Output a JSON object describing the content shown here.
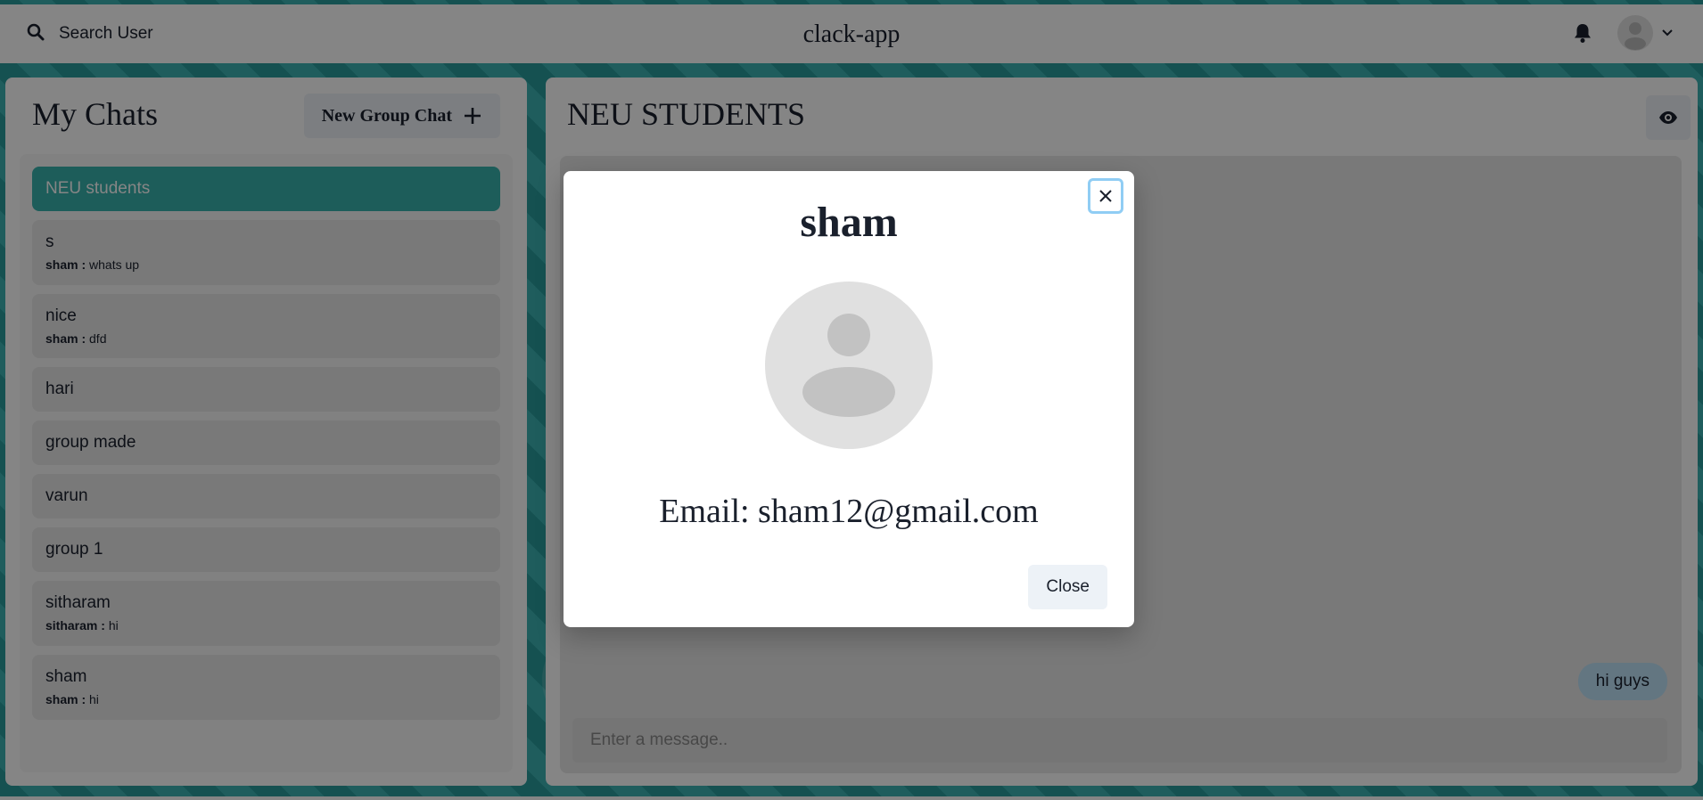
{
  "header": {
    "search_label": "Search User",
    "app_title": "clack-app",
    "bell_icon": "bell-icon",
    "avatar_icon": "user-avatar",
    "dropdown_icon": "chevron-down-icon"
  },
  "sidebar": {
    "title": "My Chats",
    "new_group_label": "New Group Chat",
    "chats": [
      {
        "name": "NEU students",
        "sender": "",
        "message": "",
        "active": true
      },
      {
        "name": "s",
        "sender": "sham :",
        "message": "whats up",
        "active": false
      },
      {
        "name": "nice",
        "sender": "sham :",
        "message": "dfd",
        "active": false
      },
      {
        "name": "hari",
        "sender": "",
        "message": "",
        "active": false
      },
      {
        "name": "group made",
        "sender": "",
        "message": "",
        "active": false
      },
      {
        "name": "varun",
        "sender": "",
        "message": "",
        "active": false
      },
      {
        "name": "group 1",
        "sender": "",
        "message": "",
        "active": false
      },
      {
        "name": "sitharam",
        "sender": "sitharam :",
        "message": "hi",
        "active": false
      },
      {
        "name": "sham",
        "sender": "sham :",
        "message": "hi",
        "active": false
      }
    ]
  },
  "chat": {
    "title": "NEU STUDENTS",
    "messages": [
      {
        "text": "hi guys",
        "own": true
      }
    ],
    "input_placeholder": "Enter a message.."
  },
  "modal": {
    "title": "sham",
    "email": "Email: sham12@gmail.com",
    "close_label": "Close"
  },
  "colors": {
    "accent": "#38b2ac",
    "bubble": "#bee3f8",
    "focus_ring": "#90cdf4"
  }
}
